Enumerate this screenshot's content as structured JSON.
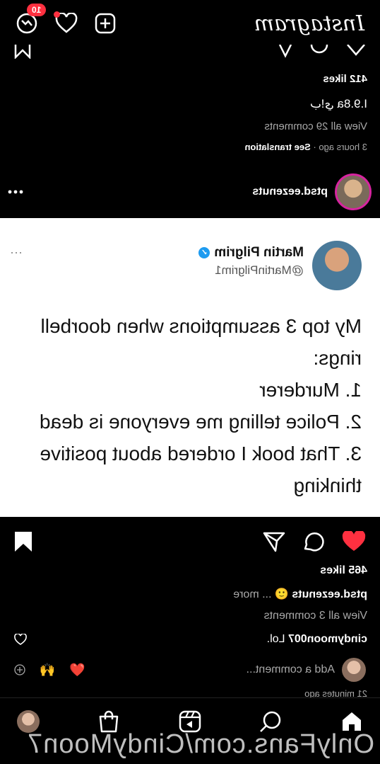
{
  "header": {
    "logo": "Instagram",
    "notification_count": "10"
  },
  "prev_post": {
    "likes": "412 likes",
    "caption": "I.9.8a ب!ي",
    "view_comments": "View all 29 comments",
    "time": "3 hours ago",
    "see_translation": "See translation"
  },
  "post": {
    "username": "ptsd.eezenuts",
    "tweet": {
      "name": "Martin Pilgrim",
      "handle": "@MartinPilgrim1",
      "more": "···",
      "line1": "My top 3 assumptions when doorbell rings:",
      "line2": "1. Murderer",
      "line3": "2. Police telling me everyone is dead",
      "line4": "3. That book I ordered about positive thinking"
    },
    "likes": "465 likes",
    "caption_user": "ptsd.eezenuts",
    "caption_more": "... more",
    "view_comments": "View all 3 comments",
    "comment_user": "cindymoon007",
    "comment_text": "Lol.",
    "add_comment_placeholder": "Add a comment...",
    "posted_time": "21 minutes ago"
  },
  "watermark": "OnlyFans.com/CindyMoon7",
  "colors": {
    "accent": "#ff3040",
    "verified": "#1d9bf0"
  }
}
